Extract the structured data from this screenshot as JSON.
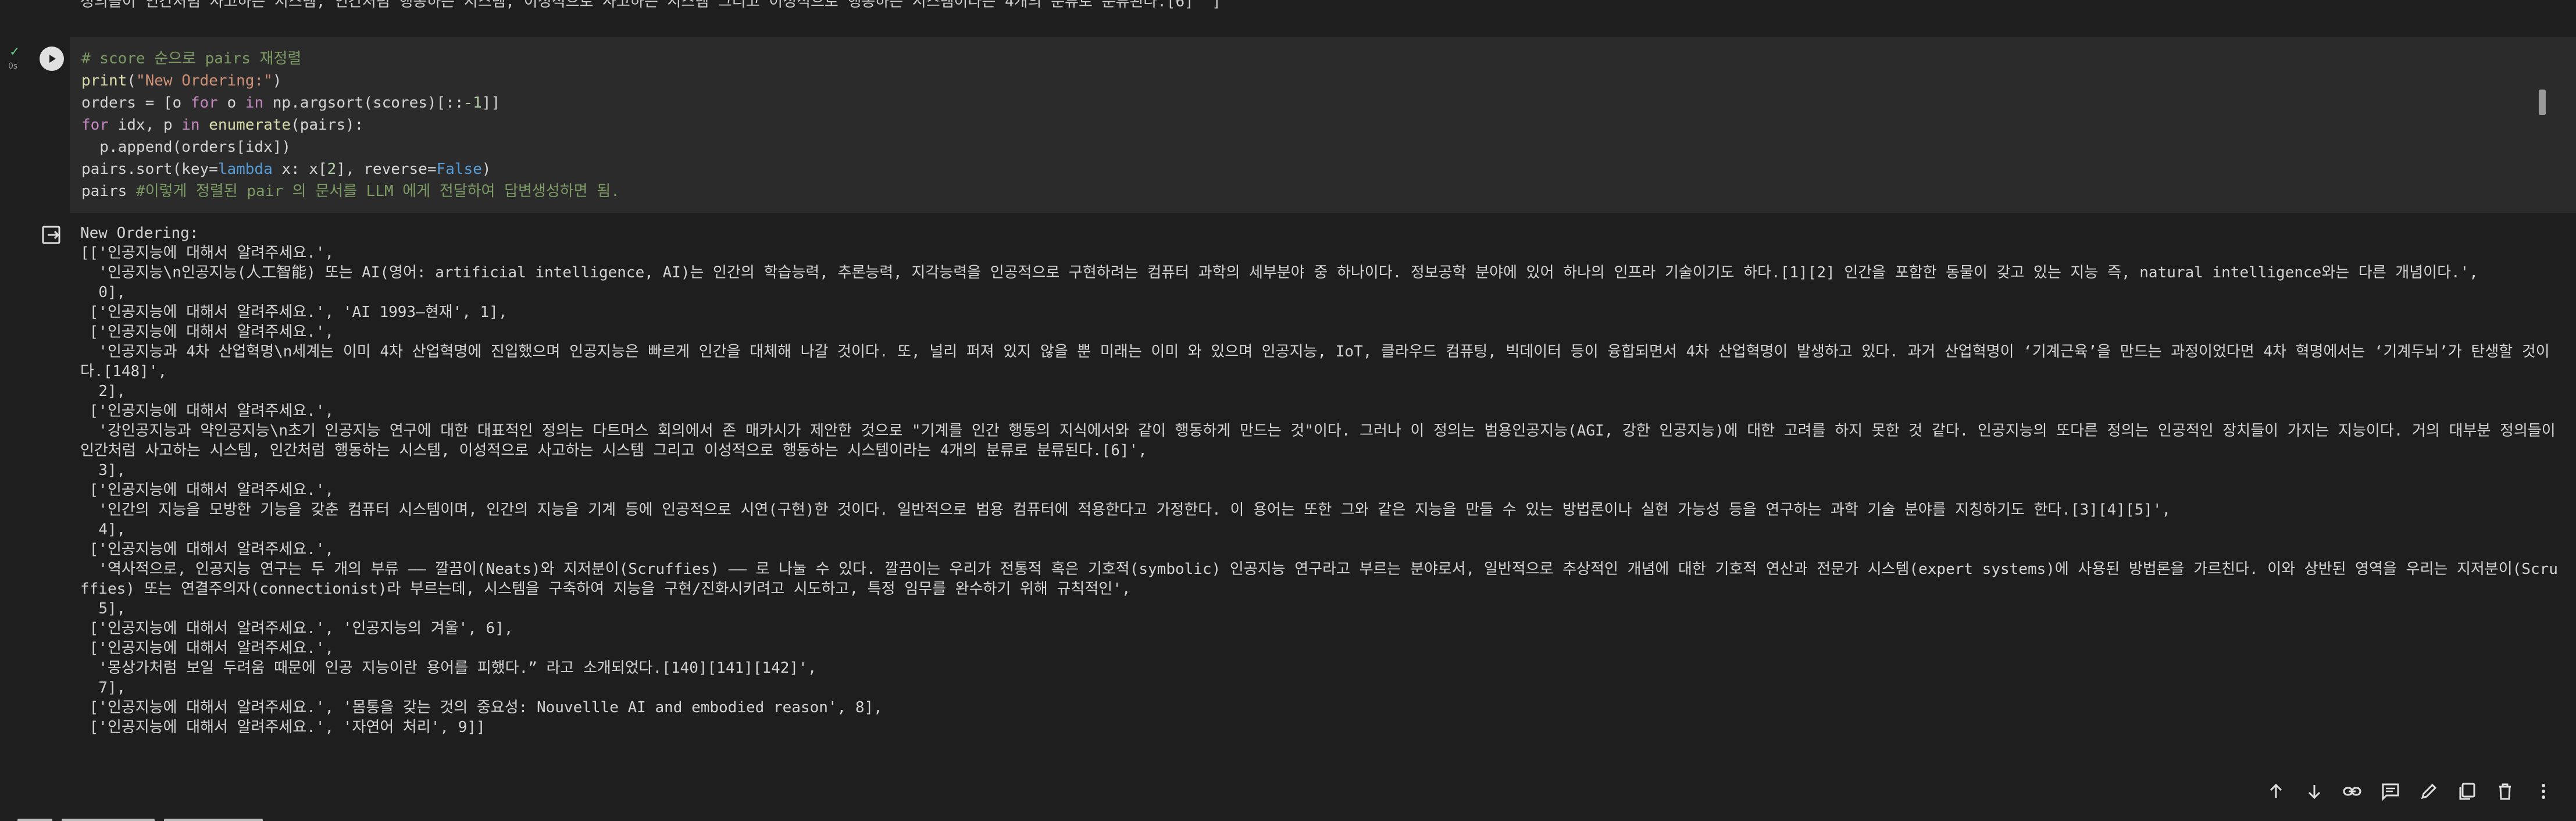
{
  "previous_output_tail": "정의들이 인간처럼 사고하는 시스템, 인간처럼 행동하는 시스템, 이성적으로 사고하는 시스템 그리고 이성적으로 행동하는 시스템이라는 4개의 분류로 분류된다.[6]'\"]",
  "cell": {
    "exec_time": "0s",
    "code": [
      [
        {
          "t": "comment",
          "v": "# score 순으로 pairs 재정렬"
        }
      ],
      [
        {
          "t": "func",
          "v": "print"
        },
        {
          "t": "plain",
          "v": "("
        },
        {
          "t": "string",
          "v": "\"New Ordering:\""
        },
        {
          "t": "plain",
          "v": ")"
        }
      ],
      [
        {
          "t": "plain",
          "v": "orders = ["
        },
        {
          "t": "plain",
          "v": "o "
        },
        {
          "t": "keyword",
          "v": "for"
        },
        {
          "t": "plain",
          "v": " o "
        },
        {
          "t": "keyword",
          "v": "in"
        },
        {
          "t": "plain",
          "v": " np.argsort(scores)[::"
        },
        {
          "t": "num",
          "v": "-1"
        },
        {
          "t": "plain",
          "v": "]]"
        }
      ],
      [
        {
          "t": "keyword",
          "v": "for"
        },
        {
          "t": "plain",
          "v": " idx, p "
        },
        {
          "t": "keyword",
          "v": "in"
        },
        {
          "t": "plain",
          "v": " "
        },
        {
          "t": "func",
          "v": "enumerate"
        },
        {
          "t": "plain",
          "v": "(pairs):"
        }
      ],
      [
        {
          "t": "plain",
          "v": "  p.append(orders[idx])"
        }
      ],
      [
        {
          "t": "plain",
          "v": "pairs.sort(key="
        },
        {
          "t": "lambda",
          "v": "lambda"
        },
        {
          "t": "plain",
          "v": " x: x["
        },
        {
          "t": "num",
          "v": "2"
        },
        {
          "t": "plain",
          "v": "], reverse="
        },
        {
          "t": "lambda",
          "v": "False"
        },
        {
          "t": "plain",
          "v": ")"
        }
      ],
      [
        {
          "t": "plain",
          "v": "pairs "
        },
        {
          "t": "comment",
          "v": "#이렇게 정렬된 pair 의 문서를 LLM 에게 전달하여 답변생성하면 됨."
        }
      ]
    ]
  },
  "output": [
    "New Ordering:",
    "[['인공지능에 대해서 알려주세요.',",
    "  '인공지능\\n인공지능(人工智能) 또는 AI(영어: artificial intelligence, AI)는 인간의 학습능력, 추론능력, 지각능력을 인공적으로 구현하려는 컴퓨터 과학의 세부분야 중 하나이다. 정보공학 분야에 있어 하나의 인프라 기술이기도 하다.[1][2] 인간을 포함한 동물이 갖고 있는 지능 즉, natural intelligence와는 다른 개념이다.',",
    "  0],",
    " ['인공지능에 대해서 알려주세요.', 'AI 1993–현재', 1],",
    " ['인공지능에 대해서 알려주세요.',",
    "  '인공지능과 4차 산업혁명\\n세계는 이미 4차 산업혁명에 진입했으며 인공지능은 빠르게 인간을 대체해 나갈 것이다. 또, 널리 퍼져 있지 않을 뿐 미래는 이미 와 있으며 인공지능, IoT, 클라우드 컴퓨팅, 빅데이터 등이 융합되면서 4차 산업혁명이 발생하고 있다. 과거 산업혁명이 ‘기계근육’을 만드는 과정이었다면 4차 혁명에서는 ‘기계두뇌’가 탄생할 것이다.[148]',",
    "  2],",
    " ['인공지능에 대해서 알려주세요.',",
    "  '강인공지능과 약인공지능\\n초기 인공지능 연구에 대한 대표적인 정의는 다트머스 회의에서 존 매카시가 제안한 것으로 \"기계를 인간 행동의 지식에서와 같이 행동하게 만드는 것\"이다. 그러나 이 정의는 범용인공지능(AGI, 강한 인공지능)에 대한 고려를 하지 못한 것 같다. 인공지능의 또다른 정의는 인공적인 장치들이 가지는 지능이다. 거의 대부분 정의들이 인간처럼 사고하는 시스템, 인간처럼 행동하는 시스템, 이성적으로 사고하는 시스템 그리고 이성적으로 행동하는 시스템이라는 4개의 분류로 분류된다.[6]',",
    "  3],",
    " ['인공지능에 대해서 알려주세요.',",
    "  '인간의 지능을 모방한 기능을 갖춘 컴퓨터 시스템이며, 인간의 지능을 기계 등에 인공적으로 시연(구현)한 것이다. 일반적으로 범용 컴퓨터에 적용한다고 가정한다. 이 용어는 또한 그와 같은 지능을 만들 수 있는 방법론이나 실현 가능성 등을 연구하는 과학 기술 분야를 지칭하기도 한다.[3][4][5]',",
    "  4],",
    " ['인공지능에 대해서 알려주세요.',",
    "  '역사적으로, 인공지능 연구는 두 개의 부류 —— 깔끔이(Neats)와 지저분이(Scruffies) —— 로 나눌 수 있다. 깔끔이는 우리가 전통적 혹은 기호적(symbolic) 인공지능 연구라고 부르는 분야로서, 일반적으로 추상적인 개념에 대한 기호적 연산과 전문가 시스템(expert systems)에 사용된 방법론을 가르친다. 이와 상반된 영역을 우리는 지저분이(Scruffies) 또는 연결주의자(connectionist)라 부르는데, 시스템을 구축하여 지능을 구현/진화시키려고 시도하고, 특정 임무를 완수하기 위해 규칙적인',",
    "  5],",
    " ['인공지능에 대해서 알려주세요.', '인공지능의 겨울', 6],",
    " ['인공지능에 대해서 알려주세요.',",
    "  '몽상가처럼 보일 두려움 때문에 인공 지능이란 용어를 피했다.” 라고 소개되었다.[140][141][142]',",
    "  7],",
    " ['인공지능에 대해서 알려주세요.', '몸통을 갖는 것의 중요성: Nouvellle AI and embodied reason', 8],",
    " ['인공지능에 대해서 알려주세요.', '자연어 처리', 9]]"
  ],
  "toolbar": {
    "icons": [
      "arrow-up-icon",
      "arrow-down-icon",
      "link-icon",
      "comment-icon",
      "edit-icon",
      "mirror-cell-icon",
      "delete-icon",
      "more-vert-icon"
    ]
  },
  "colors": {
    "background": "#1e1e1e",
    "cell_background": "#2b2b2b",
    "comment": "#7c9a63",
    "keyword": "#c586c0",
    "string": "#ce9178",
    "check": "#6bd18f"
  }
}
